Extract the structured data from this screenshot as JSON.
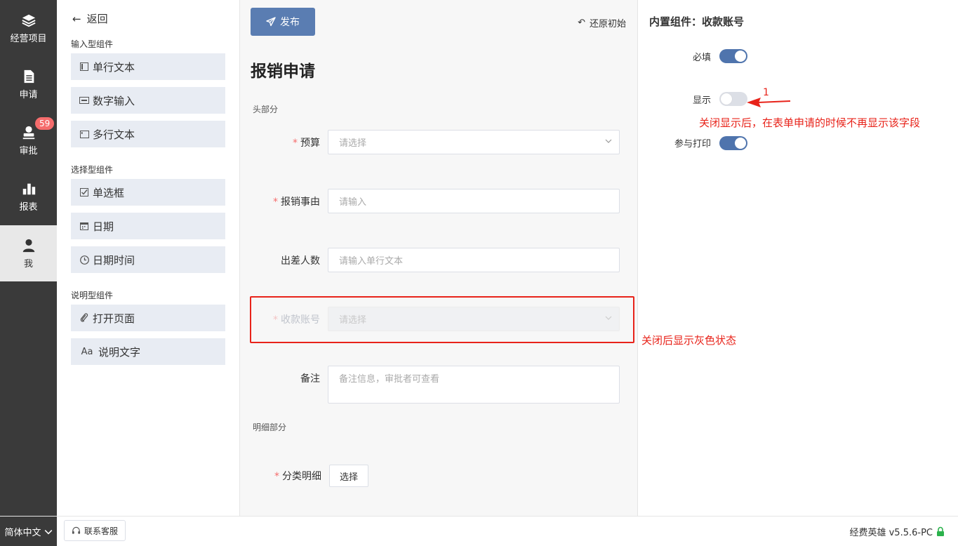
{
  "nav": {
    "items": [
      {
        "label": "经营项目",
        "icon": "layers-icon"
      },
      {
        "label": "申请",
        "icon": "document-icon"
      },
      {
        "label": "审批",
        "icon": "stamp-icon"
      },
      {
        "label": "报表",
        "icon": "bar-chart-icon"
      },
      {
        "label": "我",
        "icon": "user-icon"
      }
    ],
    "badge": "59"
  },
  "bottom": {
    "language": "简体中文",
    "support": "联系客服",
    "version": "经费英雄 v5.5.6-PC"
  },
  "palette": {
    "back": "返回",
    "groups": [
      {
        "title": "输入型组件",
        "items": [
          "单行文本",
          "数字输入",
          "多行文本"
        ]
      },
      {
        "title": "选择型组件",
        "items": [
          "单选框",
          "日期",
          "日期时间"
        ]
      },
      {
        "title": "说明型组件",
        "items": [
          "打开页面",
          "说明文字"
        ]
      }
    ],
    "text_icon": "Aa"
  },
  "canvas": {
    "publish": "发布",
    "reset": "还原初始",
    "title": "报销申请",
    "head_section": "头部分",
    "detail_section": "明细部分",
    "fields": {
      "budget": {
        "label": "预算",
        "placeholder": "请选择"
      },
      "reason": {
        "label": "报销事由",
        "placeholder": "请输入"
      },
      "travelers": {
        "label": "出差人数",
        "placeholder": "请输入单行文本"
      },
      "account": {
        "label": "收款账号",
        "placeholder": "请选择"
      },
      "remark": {
        "label": "备注",
        "placeholder": "备注信息，审批者可查看"
      },
      "category": {
        "label": "分类明细",
        "button": "选择"
      }
    },
    "required_mark": "*"
  },
  "props": {
    "title": "内置组件：收款账号",
    "required": {
      "label": "必填",
      "on": true
    },
    "visible": {
      "label": "显示",
      "on": false
    },
    "print": {
      "label": "参与打印",
      "on": true
    }
  },
  "annotations": {
    "marker": "1",
    "visible_note": "关闭显示后，在表单申请的时候不再显示该字段",
    "gray_note": "关闭后显示灰色状态",
    "color": "#e8231a"
  }
}
